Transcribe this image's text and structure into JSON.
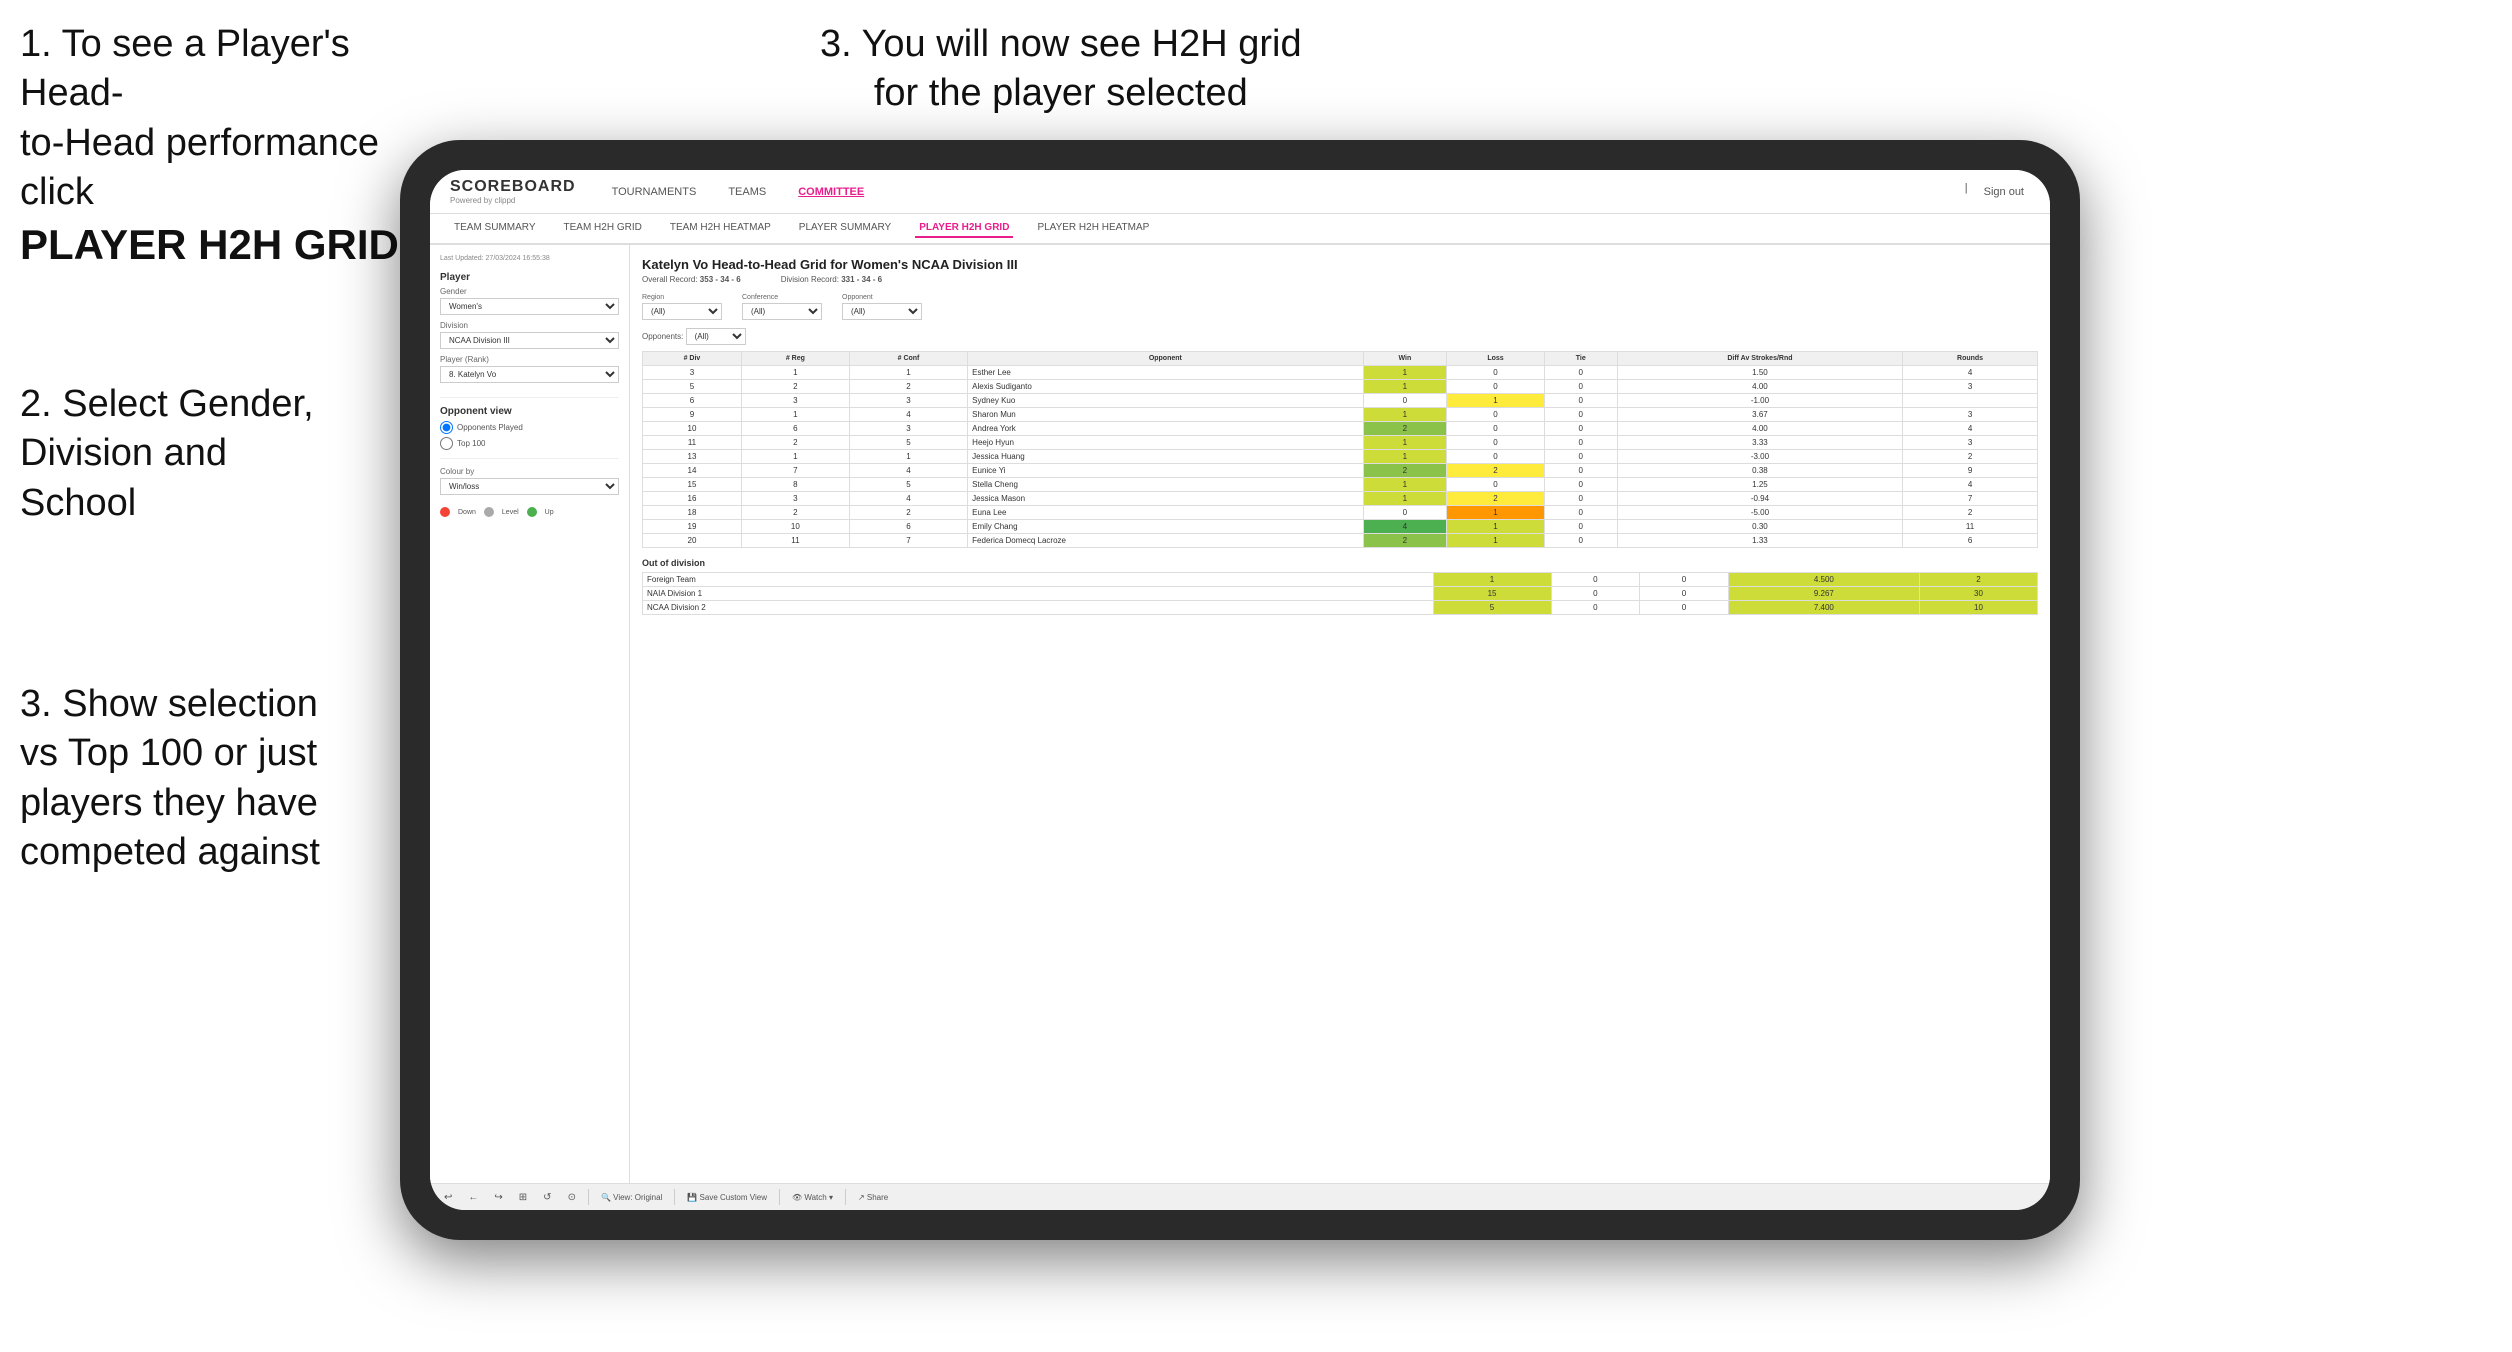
{
  "instructions": {
    "top_left_line1": "1. To see a Player's Head-",
    "top_left_line2": "to-Head performance click",
    "top_left_line3": "PLAYER H2H GRID",
    "top_right": "3. You will now see H2H grid\nfor the player selected",
    "mid_left_line1": "2. Select Gender,",
    "mid_left_line2": "Division and",
    "mid_left_line3": "School",
    "bottom_left_line1": "3. Show selection",
    "bottom_left_line2": "vs Top 100 or just",
    "bottom_left_line3": "players they have",
    "bottom_left_line4": "competed against"
  },
  "navbar": {
    "logo": "SCOREBOARD",
    "logo_sub": "Powered by clippd",
    "nav_items": [
      "TOURNAMENTS",
      "TEAMS",
      "COMMITTEE"
    ],
    "nav_right": [
      "Sign out"
    ]
  },
  "subnav": {
    "items": [
      "TEAM SUMMARY",
      "TEAM H2H GRID",
      "TEAM H2H HEATMAP",
      "PLAYER SUMMARY",
      "PLAYER H2H GRID",
      "PLAYER H2H HEATMAP"
    ]
  },
  "sidebar": {
    "updated": "Last Updated: 27/03/2024 16:55:38",
    "player_section": "Player",
    "gender_label": "Gender",
    "gender_value": "Women's",
    "division_label": "Division",
    "division_value": "NCAA Division III",
    "player_rank_label": "Player (Rank)",
    "player_rank_value": "8. Katelyn Vo",
    "opponent_view_title": "Opponent view",
    "opponent_view_options": [
      "Opponents Played",
      "Top 100"
    ],
    "colour_by_label": "Colour by",
    "colour_by_value": "Win/loss",
    "legend": {
      "down": "Down",
      "level": "Level",
      "up": "Up"
    }
  },
  "grid": {
    "title": "Katelyn Vo Head-to-Head Grid for Women's NCAA Division III",
    "overall_record_label": "Overall Record:",
    "overall_record": "353 - 34 - 6",
    "division_record_label": "Division Record:",
    "division_record": "331 - 34 - 6",
    "region_label": "Region",
    "conference_label": "Conference",
    "opponent_label": "Opponent",
    "opponents_label": "Opponents:",
    "filter_all": "(All)",
    "columns": [
      "# Div",
      "# Reg",
      "# Conf",
      "Opponent",
      "Win",
      "Loss",
      "Tie",
      "Diff Av Strokes/Rnd",
      "Rounds"
    ],
    "rows": [
      {
        "div": "3",
        "reg": "1",
        "conf": "1",
        "opponent": "Esther Lee",
        "win": 1,
        "loss": 0,
        "tie": 0,
        "diff": "1.50",
        "rounds": 4,
        "win_color": "green_light",
        "loss_color": "white",
        "tie_color": "white"
      },
      {
        "div": "5",
        "reg": "2",
        "conf": "2",
        "opponent": "Alexis Sudiganto",
        "win": 1,
        "loss": 0,
        "tie": 0,
        "diff": "4.00",
        "rounds": 3,
        "win_color": "green_light",
        "loss_color": "white",
        "tie_color": "white"
      },
      {
        "div": "6",
        "reg": "3",
        "conf": "3",
        "opponent": "Sydney Kuo",
        "win": 0,
        "loss": 1,
        "tie": 0,
        "diff": "-1.00",
        "rounds": "",
        "win_color": "white",
        "loss_color": "yellow",
        "tie_color": "white"
      },
      {
        "div": "9",
        "reg": "1",
        "conf": "4",
        "opponent": "Sharon Mun",
        "win": 1,
        "loss": 0,
        "tie": 0,
        "diff": "3.67",
        "rounds": 3,
        "win_color": "green_light",
        "loss_color": "white",
        "tie_color": "white"
      },
      {
        "div": "10",
        "reg": "6",
        "conf": "3",
        "opponent": "Andrea York",
        "win": 2,
        "loss": 0,
        "tie": 0,
        "diff": "4.00",
        "rounds": 4,
        "win_color": "green_med",
        "loss_color": "white",
        "tie_color": "white"
      },
      {
        "div": "11",
        "reg": "2",
        "conf": "5",
        "opponent": "Heejo Hyun",
        "win": 1,
        "loss": 0,
        "tie": 0,
        "diff": "3.33",
        "rounds": 3,
        "win_color": "green_light",
        "loss_color": "white",
        "tie_color": "white"
      },
      {
        "div": "13",
        "reg": "1",
        "conf": "1",
        "opponent": "Jessica Huang",
        "win": 1,
        "loss": 0,
        "tie": 0,
        "diff": "-3.00",
        "rounds": 2,
        "win_color": "green_light",
        "loss_color": "white",
        "tie_color": "white"
      },
      {
        "div": "14",
        "reg": "7",
        "conf": "4",
        "opponent": "Eunice Yi",
        "win": 2,
        "loss": 2,
        "tie": 0,
        "diff": "0.38",
        "rounds": 9,
        "win_color": "green_med",
        "loss_color": "yellow",
        "tie_color": "white"
      },
      {
        "div": "15",
        "reg": "8",
        "conf": "5",
        "opponent": "Stella Cheng",
        "win": 1,
        "loss": 0,
        "tie": 0,
        "diff": "1.25",
        "rounds": 4,
        "win_color": "green_light",
        "loss_color": "white",
        "tie_color": "white"
      },
      {
        "div": "16",
        "reg": "3",
        "conf": "4",
        "opponent": "Jessica Mason",
        "win": 1,
        "loss": 2,
        "tie": 0,
        "diff": "-0.94",
        "rounds": 7,
        "win_color": "green_light",
        "loss_color": "yellow",
        "tie_color": "white"
      },
      {
        "div": "18",
        "reg": "2",
        "conf": "2",
        "opponent": "Euna Lee",
        "win": 0,
        "loss": 1,
        "tie": 0,
        "diff": "-5.00",
        "rounds": 2,
        "win_color": "white",
        "loss_color": "orange",
        "tie_color": "white"
      },
      {
        "div": "19",
        "reg": "10",
        "conf": "6",
        "opponent": "Emily Chang",
        "win": 4,
        "loss": 1,
        "tie": 0,
        "diff": "0.30",
        "rounds": 11,
        "win_color": "green_dark",
        "loss_color": "green_light",
        "tie_color": "white"
      },
      {
        "div": "20",
        "reg": "11",
        "conf": "7",
        "opponent": "Federica Domecq Lacroze",
        "win": 2,
        "loss": 1,
        "tie": 0,
        "diff": "1.33",
        "rounds": 6,
        "win_color": "green_med",
        "loss_color": "green_light",
        "tie_color": "white"
      }
    ],
    "out_of_division_title": "Out of division",
    "out_of_division_rows": [
      {
        "label": "Foreign Team",
        "win": 1,
        "loss": 0,
        "tie": 0,
        "diff": "4.500",
        "rounds": 2
      },
      {
        "label": "NAIA Division 1",
        "win": 15,
        "loss": 0,
        "tie": 0,
        "diff": "9.267",
        "rounds": 30
      },
      {
        "label": "NCAA Division 2",
        "win": 5,
        "loss": 0,
        "tie": 0,
        "diff": "7.400",
        "rounds": 10
      }
    ]
  },
  "toolbar": {
    "buttons": [
      "↩",
      "←",
      "↪",
      "⊞",
      "↺",
      "⊙",
      "🔍"
    ],
    "view_original": "View: Original",
    "save_custom": "Save Custom View",
    "watch": "Watch ▾",
    "share": "Share"
  }
}
